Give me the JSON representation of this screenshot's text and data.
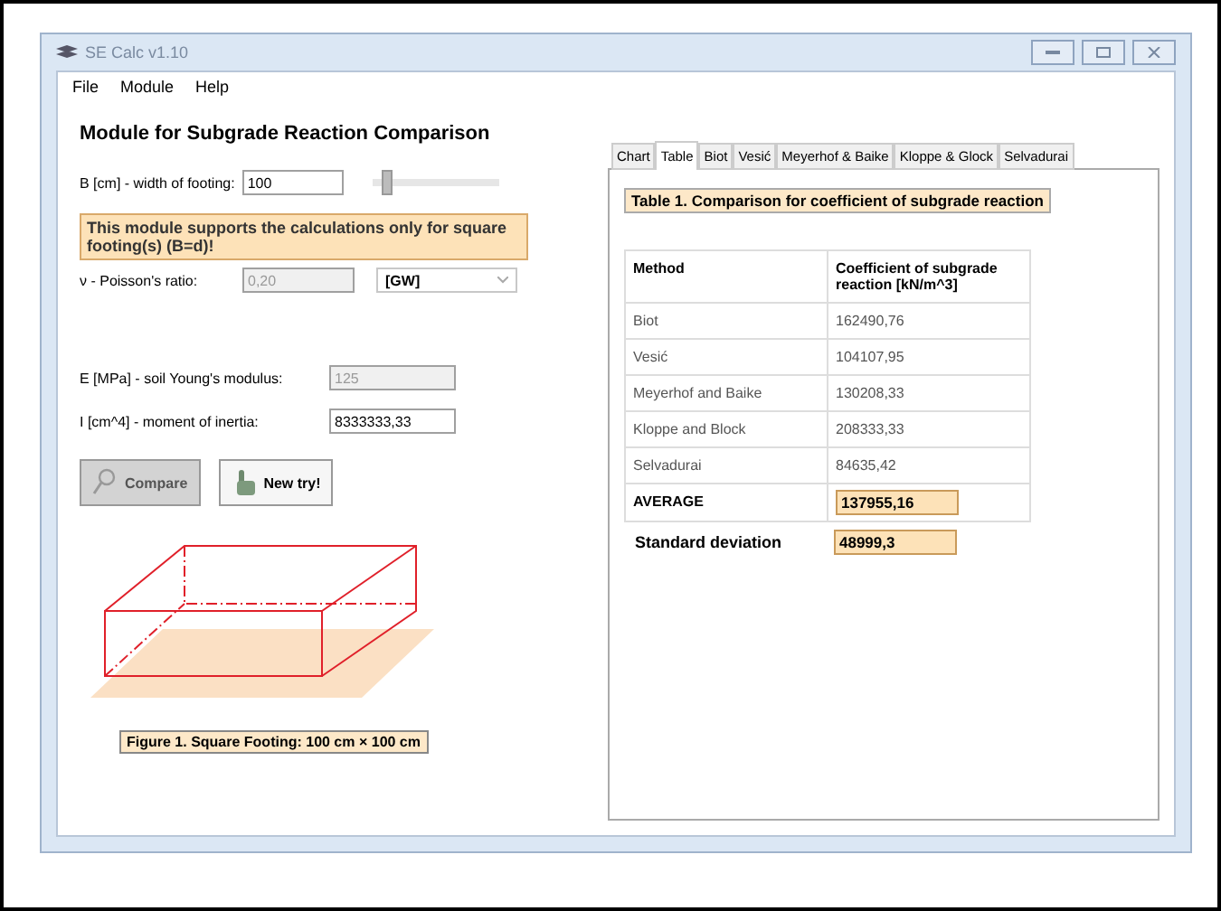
{
  "window": {
    "title": "SE Calc v1.10"
  },
  "menu": [
    "File",
    "Module",
    "Help"
  ],
  "module_title": "Module for Subgrade Reaction Comparison",
  "width_field": {
    "label": "B [cm] - width of footing:",
    "value": "100",
    "slider": {
      "level": 0.12
    }
  },
  "notice": "This module  supports the calculations only for square footing(s) (B=d)!",
  "poisson": {
    "label": "ν - Poisson's ratio:",
    "value": "0,20",
    "disabled": true,
    "soil": "[GW]"
  },
  "fields": [
    {
      "label": "E [MPa] - soil Young's modulus:",
      "value": "125",
      "disabled": true
    },
    {
      "label": "I [cm^4] - moment of inertia:",
      "value": "8333333,33",
      "disabled": false
    }
  ],
  "buttons": [
    {
      "label": "Compare",
      "kind": "search",
      "pressed": true
    },
    {
      "label": "New try!",
      "kind": "hand",
      "pressed": false
    }
  ],
  "figure_caption": "Figure 1. Square Footing: 100 cm × 100 cm",
  "tabs": [
    {
      "label": "Chart",
      "selected": false
    },
    {
      "label": "Table",
      "selected": true
    },
    {
      "label": "Biot",
      "selected": false
    },
    {
      "label": "Vesić",
      "selected": false
    },
    {
      "label": "Meyerhof & Baike",
      "selected": false
    },
    {
      "label": "Kloppe & Glock",
      "selected": false
    },
    {
      "label": "Selvadurai",
      "selected": false
    }
  ],
  "table": {
    "caption": "Table 1. Comparison for coefficient of subgrade reaction",
    "columns": [
      "Method",
      "Coefficient of subgrade reaction [kN/m^3]"
    ],
    "rows": [
      [
        "Biot",
        "162490,76"
      ],
      [
        "Vesić",
        "104107,95"
      ],
      [
        "Meyerhof and Baike",
        "130208,33"
      ],
      [
        "Kloppe and Block",
        "208333,33"
      ],
      [
        "Selvadurai",
        "84635,42"
      ]
    ],
    "average": {
      "label": "AVERAGE",
      "value": "137955,16"
    },
    "std": {
      "label": "Standard deviation",
      "value": "48999,3"
    }
  }
}
